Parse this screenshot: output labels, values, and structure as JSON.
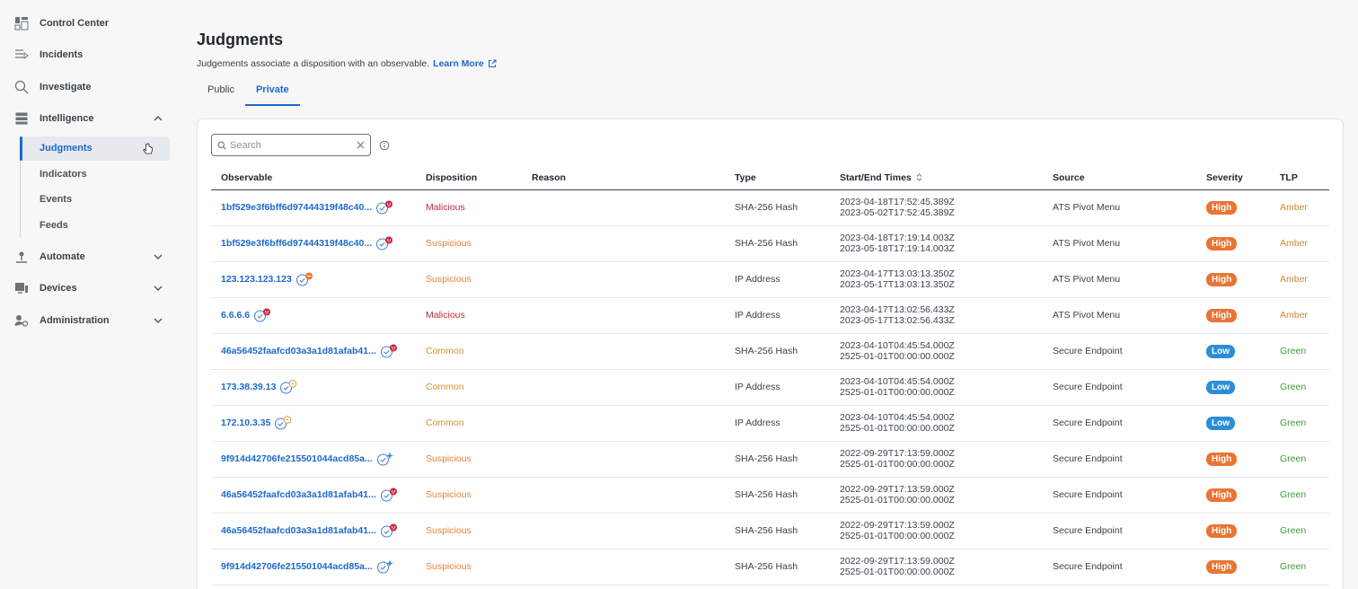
{
  "sidebar": {
    "items": [
      {
        "label": "Control Center",
        "icon": "dashboard-icon",
        "chevron": null
      },
      {
        "label": "Incidents",
        "icon": "incidents-icon",
        "chevron": null
      },
      {
        "label": "Investigate",
        "icon": "search-icon",
        "chevron": null
      },
      {
        "label": "Intelligence",
        "icon": "intelligence-icon",
        "chevron": "up"
      },
      {
        "label": "Automate",
        "icon": "automate-icon",
        "chevron": "down"
      },
      {
        "label": "Devices",
        "icon": "devices-icon",
        "chevron": "down"
      },
      {
        "label": "Administration",
        "icon": "admin-icon",
        "chevron": "down"
      }
    ],
    "subitems": [
      {
        "label": "Judgments",
        "active": true
      },
      {
        "label": "Indicators",
        "active": false
      },
      {
        "label": "Events",
        "active": false
      },
      {
        "label": "Feeds",
        "active": false
      }
    ]
  },
  "page": {
    "title": "Judgments",
    "description": "Judgements associate a disposition with an observable.",
    "learn_more": "Learn More"
  },
  "tabs": [
    {
      "label": "Public",
      "active": false
    },
    {
      "label": "Private",
      "active": true
    }
  ],
  "search": {
    "placeholder": "Search",
    "value": ""
  },
  "table": {
    "columns": [
      "Observable",
      "Disposition",
      "Reason",
      "Type",
      "Start/End Times",
      "Source",
      "Severity",
      "TLP"
    ],
    "rows": [
      {
        "observable": "1bf529e3f6bff6d97444319f48c40...",
        "obs_icon": "malicious",
        "disposition": "Malicious",
        "reason": "",
        "type": "SHA-256 Hash",
        "start": "2023-04-18T17:52:45.389Z",
        "end": "2023-05-02T17:52:45.389Z",
        "source": "ATS Pivot Menu",
        "severity": "High",
        "tlp": "Amber"
      },
      {
        "observable": "1bf529e3f6bff6d97444319f48c40...",
        "obs_icon": "malicious",
        "disposition": "Suspicious",
        "reason": "",
        "type": "SHA-256 Hash",
        "start": "2023-04-18T17:19:14.003Z",
        "end": "2023-05-18T17:19:14.003Z",
        "source": "ATS Pivot Menu",
        "severity": "High",
        "tlp": "Amber"
      },
      {
        "observable": "123.123.123.123",
        "obs_icon": "suspicious",
        "disposition": "Suspicious",
        "reason": "",
        "type": "IP Address",
        "start": "2023-04-17T13:03:13.350Z",
        "end": "2023-05-17T13:03:13.350Z",
        "source": "ATS Pivot Menu",
        "severity": "High",
        "tlp": "Amber"
      },
      {
        "observable": "6.6.6.6",
        "obs_icon": "malicious",
        "disposition": "Malicious",
        "reason": "",
        "type": "IP Address",
        "start": "2023-04-17T13:02:56.433Z",
        "end": "2023-05-17T13:02:56.433Z",
        "source": "ATS Pivot Menu",
        "severity": "High",
        "tlp": "Amber"
      },
      {
        "observable": "46a56452faafcd03a3a1d81afab41...",
        "obs_icon": "malicious",
        "disposition": "Common",
        "reason": "",
        "type": "SHA-256 Hash",
        "start": "2023-04-10T04:45:54.000Z",
        "end": "2525-01-01T00:00:00.000Z",
        "source": "Secure Endpoint",
        "severity": "Low",
        "tlp": "Green"
      },
      {
        "observable": "173.38.39.13",
        "obs_icon": "common",
        "disposition": "Common",
        "reason": "",
        "type": "IP Address",
        "start": "2023-04-10T04:45:54.000Z",
        "end": "2525-01-01T00:00:00.000Z",
        "source": "Secure Endpoint",
        "severity": "Low",
        "tlp": "Green"
      },
      {
        "observable": "172.10.3.35",
        "obs_icon": "common",
        "disposition": "Common",
        "reason": "",
        "type": "IP Address",
        "start": "2023-04-10T04:45:54.000Z",
        "end": "2525-01-01T00:00:00.000Z",
        "source": "Secure Endpoint",
        "severity": "Low",
        "tlp": "Green"
      },
      {
        "observable": "9f914d42706fe215501044acd85a...",
        "obs_icon": "sparkle",
        "disposition": "Suspicious",
        "reason": "",
        "type": "SHA-256 Hash",
        "start": "2022-09-29T17:13:59.000Z",
        "end": "2525-01-01T00:00:00.000Z",
        "source": "Secure Endpoint",
        "severity": "High",
        "tlp": "Green"
      },
      {
        "observable": "46a56452faafcd03a3a1d81afab41...",
        "obs_icon": "malicious",
        "disposition": "Suspicious",
        "reason": "",
        "type": "SHA-256 Hash",
        "start": "2022-09-29T17:13:59.000Z",
        "end": "2525-01-01T00:00:00.000Z",
        "source": "Secure Endpoint",
        "severity": "High",
        "tlp": "Green"
      },
      {
        "observable": "46a56452faafcd03a3a1d81afab41...",
        "obs_icon": "malicious",
        "disposition": "Suspicious",
        "reason": "",
        "type": "SHA-256 Hash",
        "start": "2022-09-29T17:13:59.000Z",
        "end": "2525-01-01T00:00:00.000Z",
        "source": "Secure Endpoint",
        "severity": "High",
        "tlp": "Green"
      },
      {
        "observable": "9f914d42706fe215501044acd85a...",
        "obs_icon": "sparkle",
        "disposition": "Suspicious",
        "reason": "",
        "type": "SHA-256 Hash",
        "start": "2022-09-29T17:13:59.000Z",
        "end": "2525-01-01T00:00:00.000Z",
        "source": "Secure Endpoint",
        "severity": "High",
        "tlp": "Green"
      }
    ]
  },
  "colors": {
    "accent": "#1d69cc",
    "malicious": "#c4283c",
    "suspicious": "#e2833a",
    "common": "#d4942b",
    "high": "#e87535",
    "low": "#2b8fd6",
    "amber": "#c88b2d",
    "green": "#3f9a3f"
  }
}
